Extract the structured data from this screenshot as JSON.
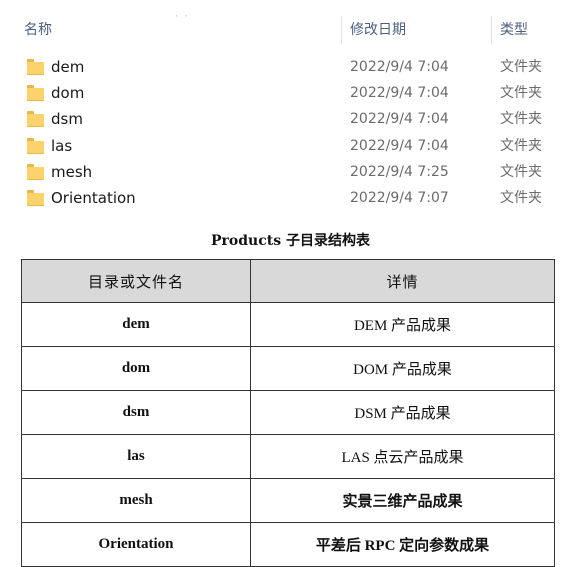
{
  "explorer": {
    "columns": {
      "name": "名称",
      "date": "修改日期",
      "type": "类型"
    },
    "folders": [
      {
        "name": "dem",
        "date": "2022/9/4 7:04",
        "type": "文件夹"
      },
      {
        "name": "dom",
        "date": "2022/9/4 7:04",
        "type": "文件夹"
      },
      {
        "name": "dsm",
        "date": "2022/9/4 7:04",
        "type": "文件夹"
      },
      {
        "name": "las",
        "date": "2022/9/4 7:04",
        "type": "文件夹"
      },
      {
        "name": "mesh",
        "date": "2022/9/4 7:25",
        "type": "文件夹"
      },
      {
        "name": "Orientation",
        "date": "2022/9/4 7:07",
        "type": "文件夹"
      }
    ]
  },
  "table": {
    "caption": "Products 子目录结构表",
    "headers": [
      "目录或文件名",
      "详情"
    ],
    "rows": [
      {
        "name": "dem",
        "detail": "DEM 产品成果"
      },
      {
        "name": "dom",
        "detail": "DOM 产品成果"
      },
      {
        "name": "dsm",
        "detail": "DSM 产品成果"
      },
      {
        "name": "las",
        "detail": "LAS 点云产品成果"
      },
      {
        "name": "mesh",
        "detail": "实景三维产品成果"
      },
      {
        "name": "Orientation",
        "detail": "平差后 RPC 定向参数成果"
      }
    ]
  }
}
